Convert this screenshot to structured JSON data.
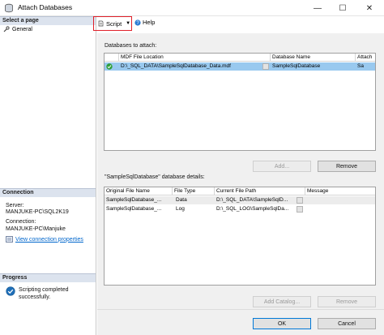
{
  "window": {
    "title": "Attach Databases",
    "minimize": "—",
    "maximize": "☐",
    "close": "✕"
  },
  "leftpane": {
    "select_page_header": "Select a page",
    "pages": [
      {
        "label": "General",
        "icon": "wrench-icon"
      }
    ],
    "connection_header": "Connection",
    "server_label": "Server:",
    "server_value": "MANJUKE-PC\\SQL2K19",
    "connection_label": "Connection:",
    "connection_value": "MANJUKE-PC\\Manjuke",
    "view_connection_link": "View connection properties",
    "progress_header": "Progress",
    "progress_status": "Scripting completed successfully."
  },
  "toolbar": {
    "script_label": "Script",
    "help_label": "Help"
  },
  "attach": {
    "section_label": "Databases to attach:",
    "columns": [
      "MDF File Location",
      "Database Name",
      "Attach"
    ],
    "rows": [
      {
        "status": "success",
        "mdf": "D:\\_SQL_DATA\\SampleSqlDatabase_Data.mdf",
        "dbname": "SampleSqlDatabase",
        "attach": "Sa"
      }
    ],
    "add_button": "Add...",
    "remove_button": "Remove"
  },
  "details": {
    "section_label": "\"SampleSqlDatabase\" database details:",
    "columns": [
      "Original File Name",
      "File Type",
      "Current File Path",
      "Message"
    ],
    "rows": [
      {
        "name": "SampleSqlDatabase_...",
        "type": "Data",
        "path": "D:\\_SQL_DATA\\SampleSqlD...",
        "message": ""
      },
      {
        "name": "SampleSqlDatabase_...",
        "type": "Log",
        "path": "D:\\_SQL_LOG\\SampleSqlDa...",
        "message": ""
      }
    ],
    "add_catalog_button": "Add Catalog...",
    "remove_button": "Remove"
  },
  "footer": {
    "ok_button": "OK",
    "cancel_button": "Cancel"
  }
}
